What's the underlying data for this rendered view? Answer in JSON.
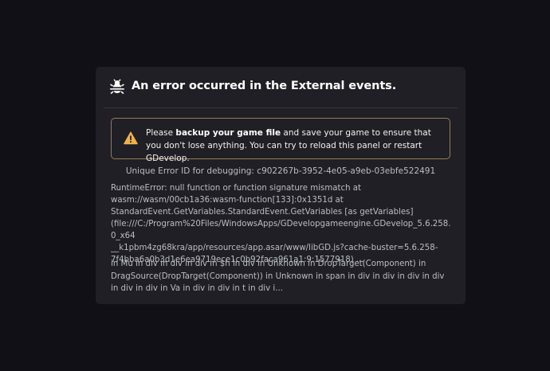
{
  "dialog": {
    "title": "An error occurred in the External events.",
    "title_icon": "bug-icon",
    "warning": {
      "icon": "warning-triangle-icon",
      "prefix": "Please ",
      "bold": "backup your game file",
      "suffix": " and save your game to ensure that you don't lose anything. You can try to reload this panel or restart GDevelop."
    },
    "error_id": "Unique Error ID for debugging: c902267b-3952-4e05-a9eb-03ebfe522491",
    "error_stack": "RuntimeError: null function or function signature mismatch at\nwasm://wasm/00cb1a36:wasm-function[133]:0x1351d at\nStandardEvent.GetVariables.StandardEvent.GetVariables [as getVariables]\n(file:///C:/Program%20Files/WindowsApps/GDevelopgameengine.GDevelop_5.6.258.0_x64\n__k1pbm4zg68kra/app/resources/app.asar/www/libGD.js?cache-buster=5.6.258-\n7f4bba6a0b3d1e6ea9719ece1c0b92faca961a1:9:1577918) ...",
    "component_stack": "in Mu in div in div in div in $h in div in Unknown in DropTarget(Component) in DragSource(DropTarget(Component)) in Unknown in span in div in div in div in div in div in div in Va in div in div in t in div i..."
  },
  "colors": {
    "background": "#111017",
    "panel": "#1f1f25",
    "warning_border": "#9a7b55",
    "warning_icon": "#f0b14a",
    "text_primary": "#ffffff",
    "text_secondary": "#bdbdc4"
  }
}
